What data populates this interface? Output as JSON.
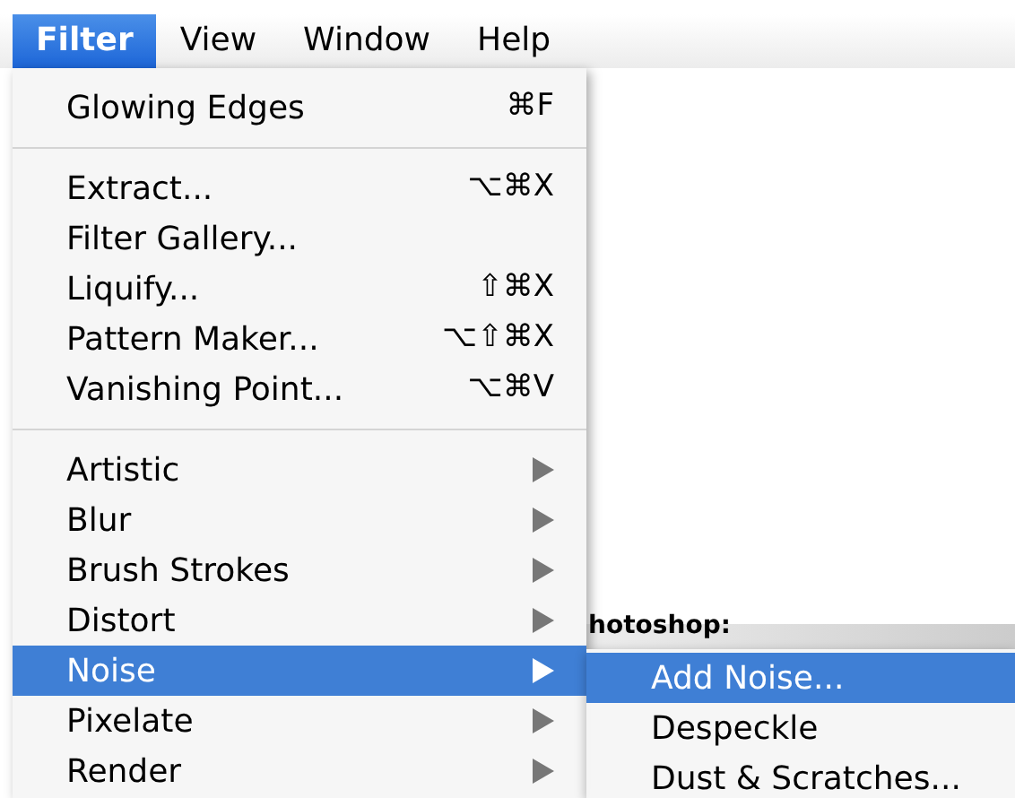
{
  "menu_bar": [
    {
      "label": "Filter",
      "selected": true
    },
    {
      "label": "View",
      "selected": false
    },
    {
      "label": "Window",
      "selected": false
    },
    {
      "label": "Help",
      "selected": false
    }
  ],
  "menu": [
    {
      "kind": "item",
      "label": "Glowing Edges",
      "shortcut": "⌘F",
      "selected": false
    },
    {
      "kind": "separator"
    },
    {
      "kind": "item",
      "label": "Extract...",
      "shortcut": "⌥⌘X",
      "selected": false
    },
    {
      "kind": "item",
      "label": "Filter Gallery...",
      "selected": false
    },
    {
      "kind": "item",
      "label": "Liquify...",
      "shortcut": "⇧⌘X",
      "selected": false
    },
    {
      "kind": "item",
      "label": "Pattern Maker...",
      "shortcut": "⌥⇧⌘X",
      "selected": false
    },
    {
      "kind": "item",
      "label": "Vanishing Point...",
      "shortcut": "⌥⌘V",
      "selected": false
    },
    {
      "kind": "separator"
    },
    {
      "kind": "submenu",
      "label": "Artistic",
      "selected": false
    },
    {
      "kind": "submenu",
      "label": "Blur",
      "selected": false
    },
    {
      "kind": "submenu",
      "label": "Brush Strokes",
      "selected": false
    },
    {
      "kind": "submenu",
      "label": "Distort",
      "selected": false
    },
    {
      "kind": "submenu",
      "label": "Noise",
      "selected": true
    },
    {
      "kind": "submenu",
      "label": "Pixelate",
      "selected": false
    },
    {
      "kind": "submenu",
      "label": "Render",
      "selected": false
    }
  ],
  "submenu": [
    {
      "label": "Add Noise...",
      "selected": true
    },
    {
      "label": "Despeckle",
      "selected": false
    },
    {
      "label": "Dust & Scratches...",
      "selected": false
    }
  ],
  "background": {
    "heading": "hotoshop:"
  }
}
